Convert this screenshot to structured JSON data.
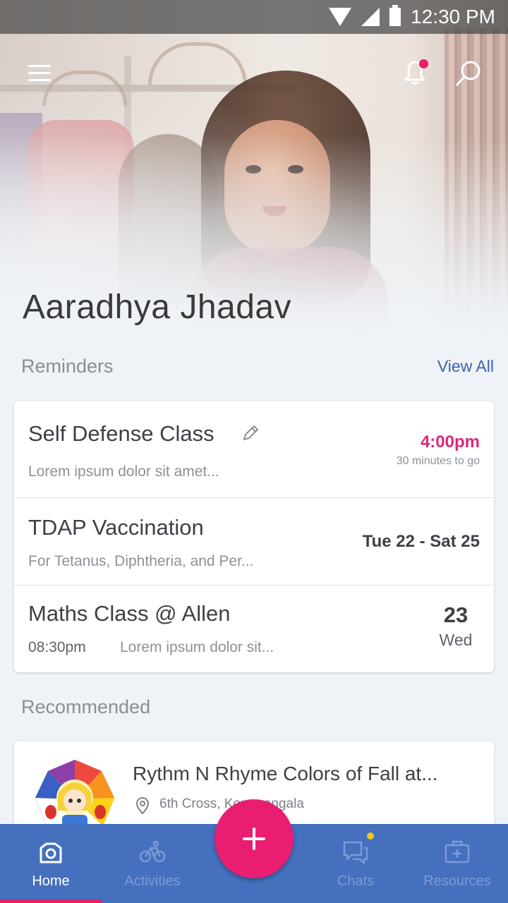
{
  "status_bar": {
    "time": "12:30 PM"
  },
  "profile": {
    "name": "Aaradhya Jhadav"
  },
  "reminders": {
    "title": "Reminders",
    "view_all": "View All",
    "items": [
      {
        "title": "Self Defense Class",
        "subtitle": "Lorem ipsum dolor sit amet...",
        "time": "4:00pm",
        "time_note": "30 minutes to go"
      },
      {
        "title": "TDAP Vaccination",
        "subtitle": "For Tetanus, Diphtheria, and Per...",
        "date_range": "Tue 22 - Sat 25"
      },
      {
        "title": "Maths Class @ Allen",
        "time": "08:30pm",
        "subtitle": "Lorem ipsum dolor sit...",
        "day": "23",
        "weekday": "Wed"
      }
    ]
  },
  "recommended": {
    "title": "Recommended",
    "items": [
      {
        "title": "Rythm N Rhyme Colors of Fall at...",
        "location": "6th Cross, Koramangala"
      }
    ]
  },
  "bottom_nav": {
    "items": [
      {
        "label": "Home",
        "active": true
      },
      {
        "label": "Activities"
      },
      {
        "label": "Chats"
      },
      {
        "label": "Resources"
      }
    ]
  },
  "colors": {
    "accent": "#e91e63",
    "nav": "#4470bd",
    "link": "#3b63b0",
    "time_highlight": "#e0267a"
  }
}
